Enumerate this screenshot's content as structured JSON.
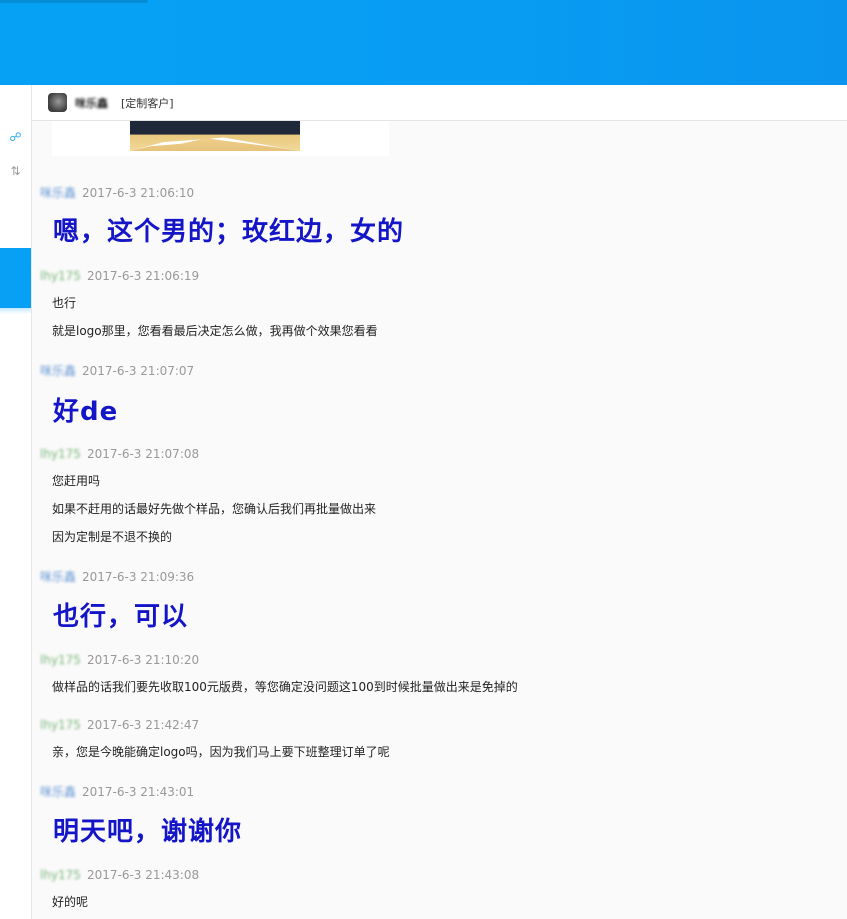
{
  "header": {
    "contact_name": "咪乐鑫",
    "contact_tag": "[定制客户]"
  },
  "icons": {
    "share": "share-icon",
    "sort": "sort-icon"
  },
  "messages": [
    {
      "sender": "咪乐鑫",
      "role": "customer",
      "time": "2017-6-3 21:06:10",
      "lines": [
        "嗯，这个男的；玫红边，女的"
      ],
      "big": true
    },
    {
      "sender": "lhy175",
      "role": "service",
      "time": "2017-6-3 21:06:19",
      "lines": [
        "也行",
        "就是logo那里，您看看最后决定怎么做，我再做个效果您看看"
      ],
      "big": false
    },
    {
      "sender": "咪乐鑫",
      "role": "customer",
      "time": "2017-6-3 21:07:07",
      "lines": [
        "好de"
      ],
      "big": true
    },
    {
      "sender": "lhy175",
      "role": "service",
      "time": "2017-6-3 21:07:08",
      "lines": [
        "您赶用吗",
        "如果不赶用的话最好先做个样品，您确认后我们再批量做出来",
        "因为定制是不退不换的"
      ],
      "big": false
    },
    {
      "sender": "咪乐鑫",
      "role": "customer",
      "time": "2017-6-3 21:09:36",
      "lines": [
        "也行，可以"
      ],
      "big": true
    },
    {
      "sender": "lhy175",
      "role": "service",
      "time": "2017-6-3 21:10:20",
      "lines": [
        "做样品的话我们要先收取100元版费，等您确定没问题这100到时候批量做出来是免掉的"
      ],
      "big": false
    },
    {
      "sender": "lhy175",
      "role": "service",
      "time": "2017-6-3 21:42:47",
      "lines": [
        "亲，您是今晚能确定logo吗，因为我们马上要下班整理订单了呢"
      ],
      "big": false
    },
    {
      "sender": "咪乐鑫",
      "role": "customer",
      "time": "2017-6-3 21:43:01",
      "lines": [
        "明天吧，谢谢你"
      ],
      "big": true
    },
    {
      "sender": "lhy175",
      "role": "service",
      "time": "2017-6-3 21:43:08",
      "lines": [
        "好的呢"
      ],
      "big": false
    }
  ]
}
